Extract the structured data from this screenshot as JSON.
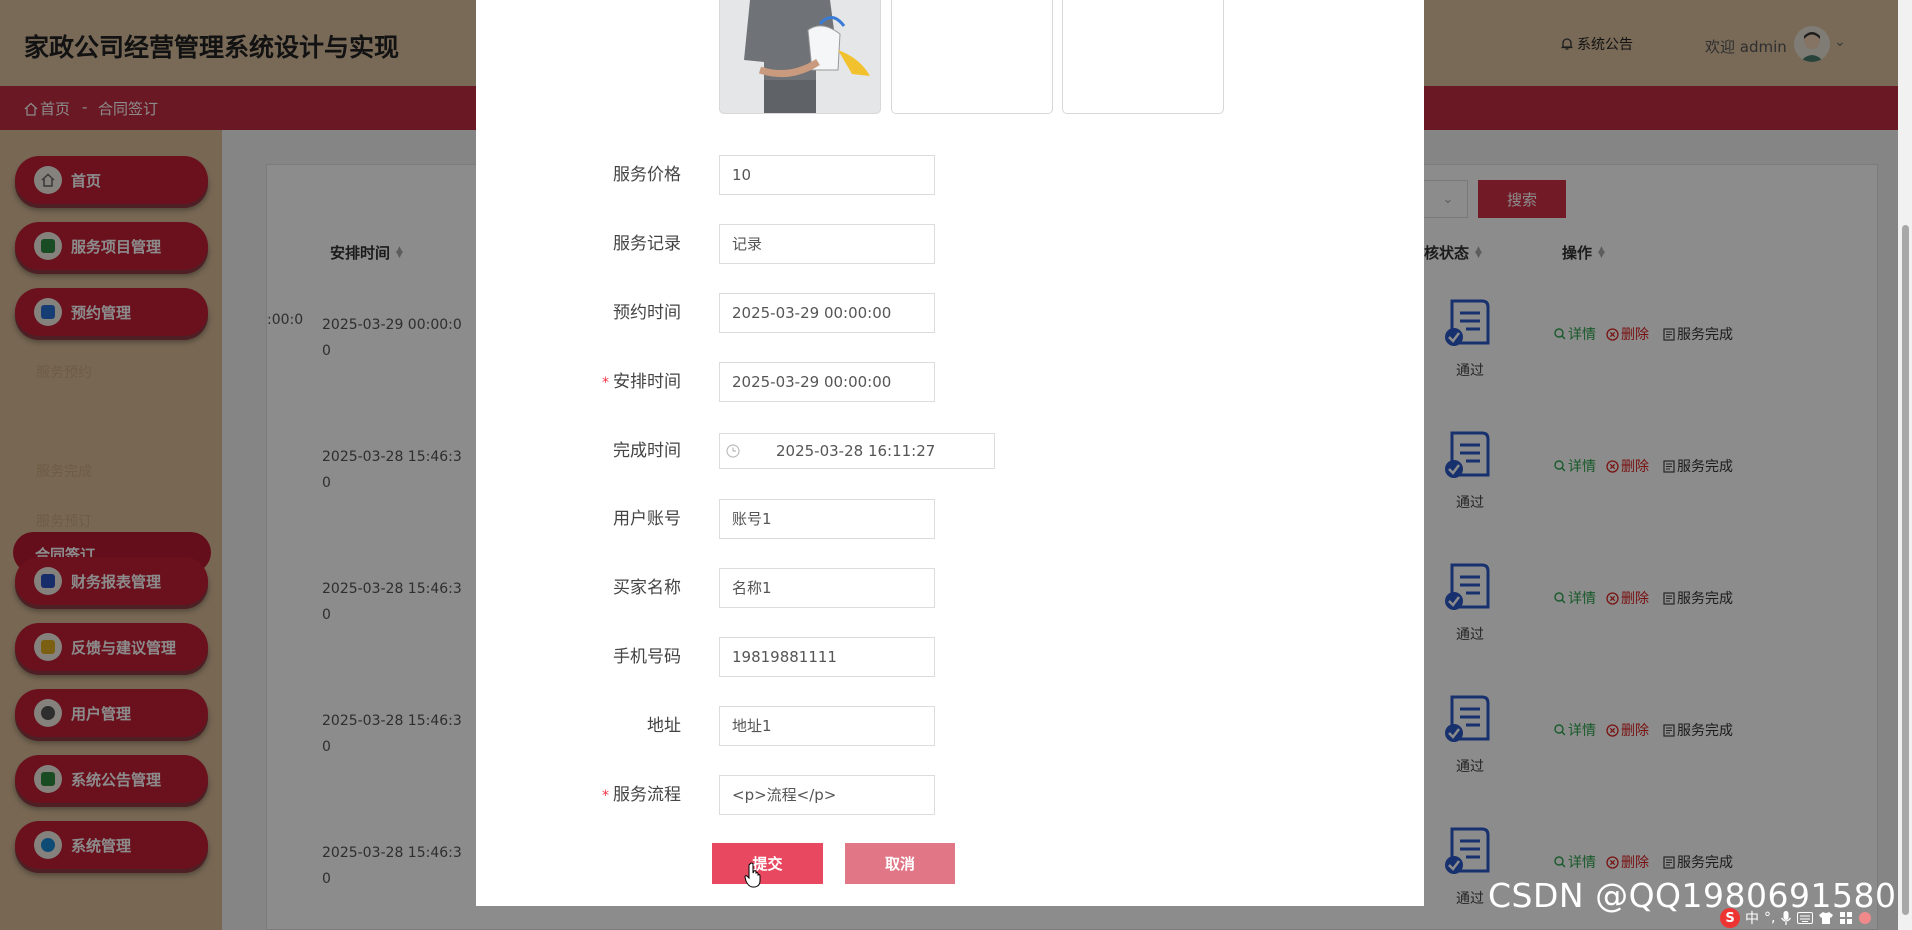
{
  "header": {
    "title": "家政公司经营管理系统设计与实现",
    "notice": "系统公告",
    "welcome": "欢迎 admin"
  },
  "breadcrumb": {
    "home": "首页",
    "separator": "-",
    "current": "合同签订"
  },
  "sidebar": {
    "items": [
      {
        "label": "首页",
        "color": "#6b6b6b"
      },
      {
        "label": "服务项目管理",
        "color": "#2e8b3e"
      },
      {
        "label": "预约管理",
        "color": "#2a6fd6"
      },
      {
        "label": "财务报表管理",
        "color": "#2a52c2"
      },
      {
        "label": "反馈与建议管理",
        "color": "#e0b020"
      },
      {
        "label": "用户管理",
        "color": "#555555"
      },
      {
        "label": "系统公告管理",
        "color": "#2e8b3e"
      },
      {
        "label": "系统管理",
        "color": "#1a8ad8"
      }
    ],
    "subitems": [
      "服务预约",
      "合同签订",
      "服务完成",
      "服务预订"
    ]
  },
  "toolbar": {
    "search_label": "搜索"
  },
  "table": {
    "headers": {
      "arrange_time": "安排时间",
      "audit_status": "核状态",
      "actions": "操作"
    },
    "cut_off_time": ":00:0",
    "rows": [
      {
        "time_line1": "2025-03-29 00:00:0",
        "time_line2": "0",
        "status": "通过"
      },
      {
        "time_line1": "2025-03-28 15:46:3",
        "time_line2": "0",
        "status": "通过"
      },
      {
        "time_line1": "2025-03-28 15:46:3",
        "time_line2": "0",
        "status": "通过"
      },
      {
        "time_line1": "2025-03-28 15:46:3",
        "time_line2": "0",
        "status": "通过"
      },
      {
        "time_line1": "2025-03-28 15:46:3",
        "time_line2": "0",
        "status": "通过"
      }
    ],
    "action_labels": {
      "detail": "详情",
      "delete": "删除",
      "complete": "服务完成"
    }
  },
  "form": {
    "fields": [
      {
        "label": "服务价格",
        "value": "10",
        "required": ""
      },
      {
        "label": "服务记录",
        "value": "记录",
        "required": ""
      },
      {
        "label": "预约时间",
        "value": "2025-03-29 00:00:00",
        "required": ""
      },
      {
        "label": "安排时间",
        "value": "2025-03-29 00:00:00",
        "required": "*"
      },
      {
        "label": "完成时间",
        "value": "2025-03-28 16:11:27",
        "required": ""
      },
      {
        "label": "用户账号",
        "value": "账号1",
        "required": ""
      },
      {
        "label": "买家名称",
        "value": "名称1",
        "required": ""
      },
      {
        "label": "手机号码",
        "value": "19819881111",
        "required": ""
      },
      {
        "label": "地址",
        "value": "地址1",
        "required": ""
      },
      {
        "label": "服务流程",
        "value": "<p>流程</p>",
        "required": "*"
      }
    ],
    "submit_label": "提交",
    "cancel_label": "取消"
  },
  "watermark": "CSDN @QQ1980691580",
  "tray": {
    "ime_logo": "S",
    "ime_mode": "中"
  }
}
